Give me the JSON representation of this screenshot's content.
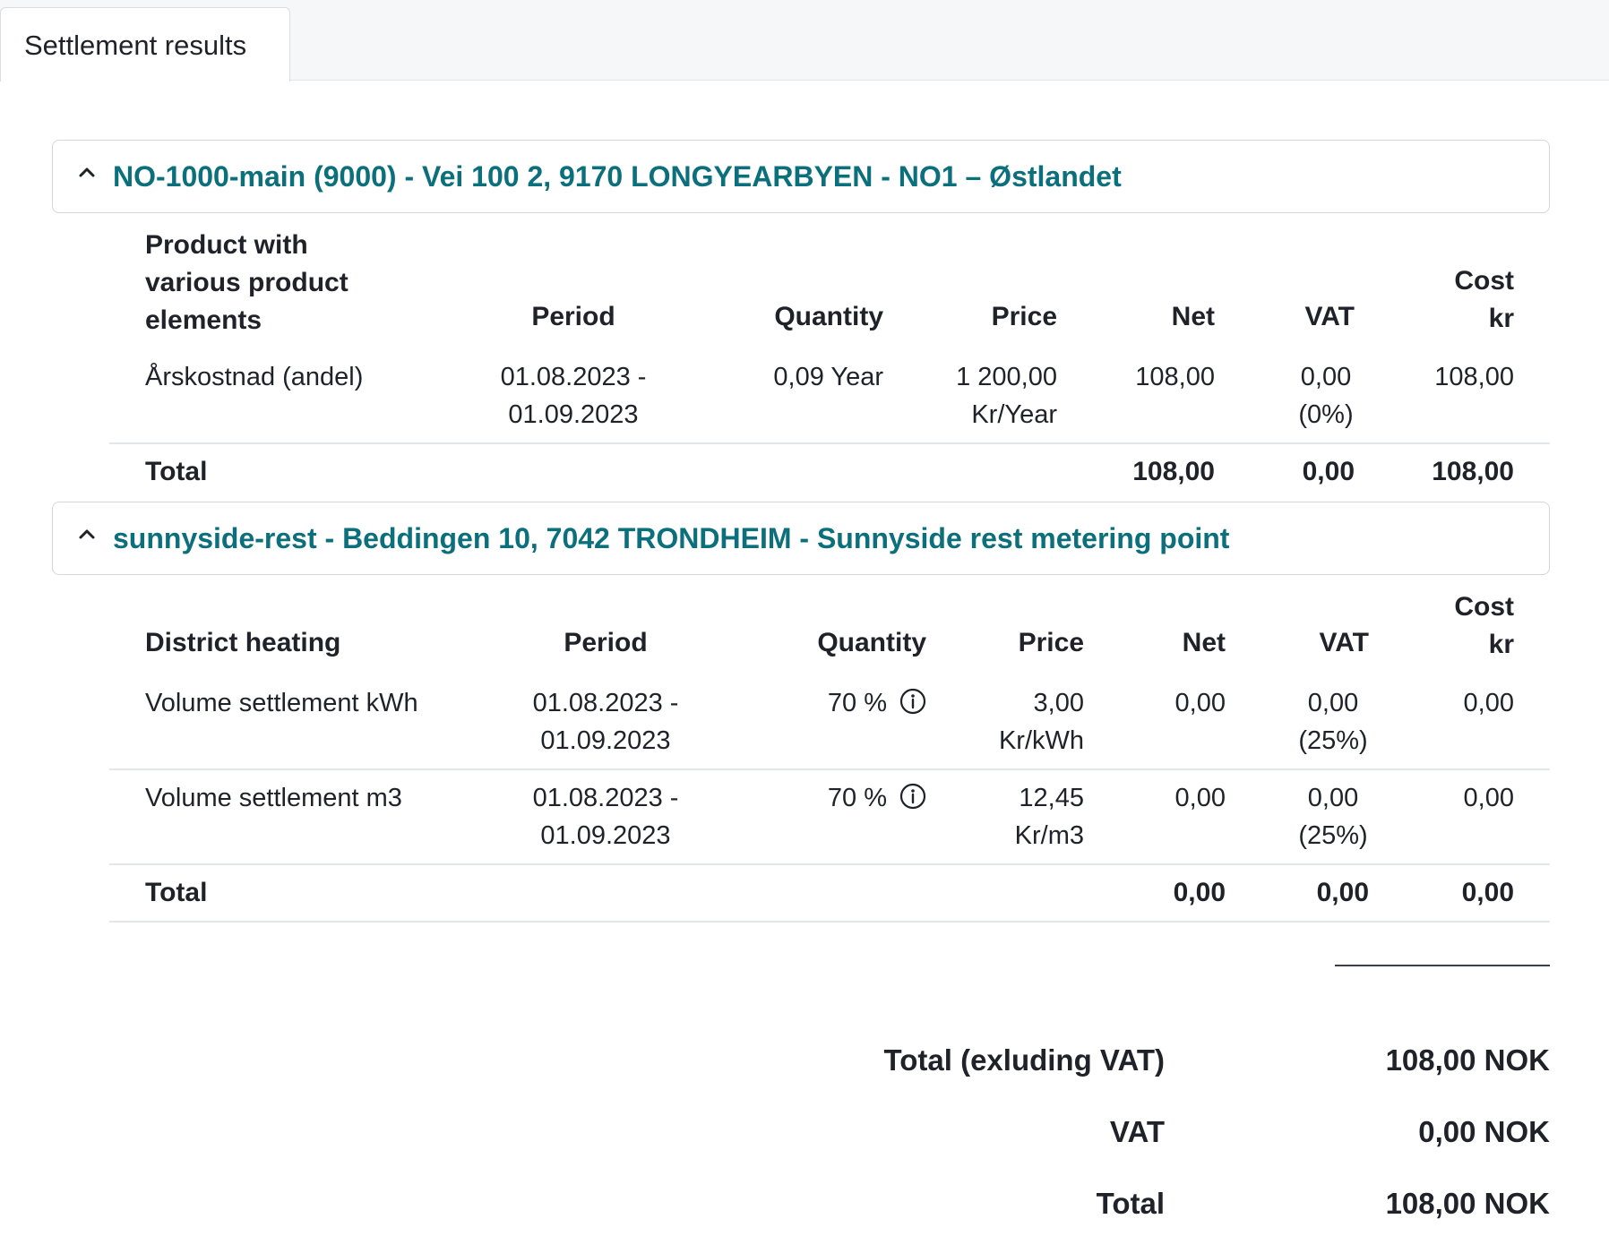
{
  "tabs": [
    {
      "label": "Settlement results"
    }
  ],
  "sections": [
    {
      "title": "NO-1000-main (9000) - Vei 100 2, 9170 LONGYEARBYEN - NO1 – Østlandet",
      "headers": {
        "product": [
          "Product with",
          "various product",
          "elements"
        ],
        "period": "Period",
        "quantity": "Quantity",
        "price": "Price",
        "net": "Net",
        "vat": "VAT",
        "cost": [
          "Cost",
          "kr"
        ]
      },
      "rows": [
        {
          "product": "Årskostnad (andel)",
          "period": [
            "01.08.2023 -",
            "01.09.2023"
          ],
          "quantity": "0,09 Year",
          "price": [
            "1 200,00",
            "Kr/Year"
          ],
          "net": "108,00",
          "vat": [
            "0,00",
            "(0%)"
          ],
          "cost": "108,00"
        }
      ],
      "total": {
        "label": "Total",
        "net": "108,00",
        "vat": "0,00",
        "cost": "108,00"
      }
    },
    {
      "title": "sunnyside-rest - Beddingen 10, 7042 TRONDHEIM - Sunnyside rest metering point",
      "headers": {
        "product": "District heating",
        "period": "Period",
        "quantity": "Quantity",
        "price": "Price",
        "net": "Net",
        "vat": "VAT",
        "cost": [
          "Cost",
          "kr"
        ]
      },
      "rows": [
        {
          "product": "Volume settlement kWh",
          "period": [
            "01.08.2023 -",
            "01.09.2023"
          ],
          "quantity": "70 %",
          "price": [
            "3,00",
            "Kr/kWh"
          ],
          "net": "0,00",
          "vat": [
            "0,00",
            "(25%)"
          ],
          "cost": "0,00"
        },
        {
          "product": "Volume settlement m3",
          "period": [
            "01.08.2023 -",
            "01.09.2023"
          ],
          "quantity": "70 %",
          "price": [
            "12,45",
            "Kr/m3"
          ],
          "net": "0,00",
          "vat": [
            "0,00",
            "(25%)"
          ],
          "cost": "0,00"
        }
      ],
      "total": {
        "label": "Total",
        "net": "0,00",
        "vat": "0,00",
        "cost": "0,00"
      }
    }
  ],
  "summary": {
    "excl_vat_label": "Total (exluding VAT)",
    "excl_vat_value": "108,00 NOK",
    "vat_label": "VAT",
    "vat_value": "0,00 NOK",
    "total_label": "Total",
    "total_value": "108,00 NOK"
  },
  "colors": {
    "accent": "#0b6f7c",
    "text": "#1f2329",
    "border": "#d3d7db"
  },
  "icons": {
    "collapse": "chevron-up-icon",
    "info": "info-icon"
  }
}
